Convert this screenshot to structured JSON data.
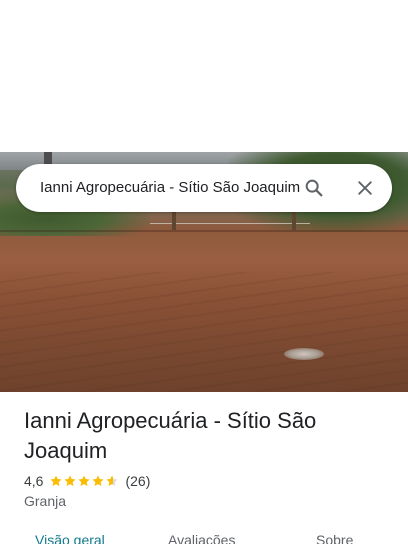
{
  "search": {
    "query": "Ianni Agropecuária - Sítio São Joaquim",
    "search_icon": "search-icon",
    "close_icon": "close-icon"
  },
  "place": {
    "name": "Ianni Agropecuária - Sítio São Joaquim",
    "rating": "4,6",
    "rating_value": 4.6,
    "max_stars": 5,
    "review_count": "(26)",
    "category": "Granja"
  },
  "tabs": [
    {
      "label": "Visão geral",
      "active": true
    },
    {
      "label": "Avaliações",
      "active": false
    },
    {
      "label": "Sobre",
      "active": false
    }
  ],
  "colors": {
    "star": "#fbbc04",
    "active_tab": "#137a8c",
    "text_primary": "#202124",
    "text_secondary": "#5f6368"
  }
}
